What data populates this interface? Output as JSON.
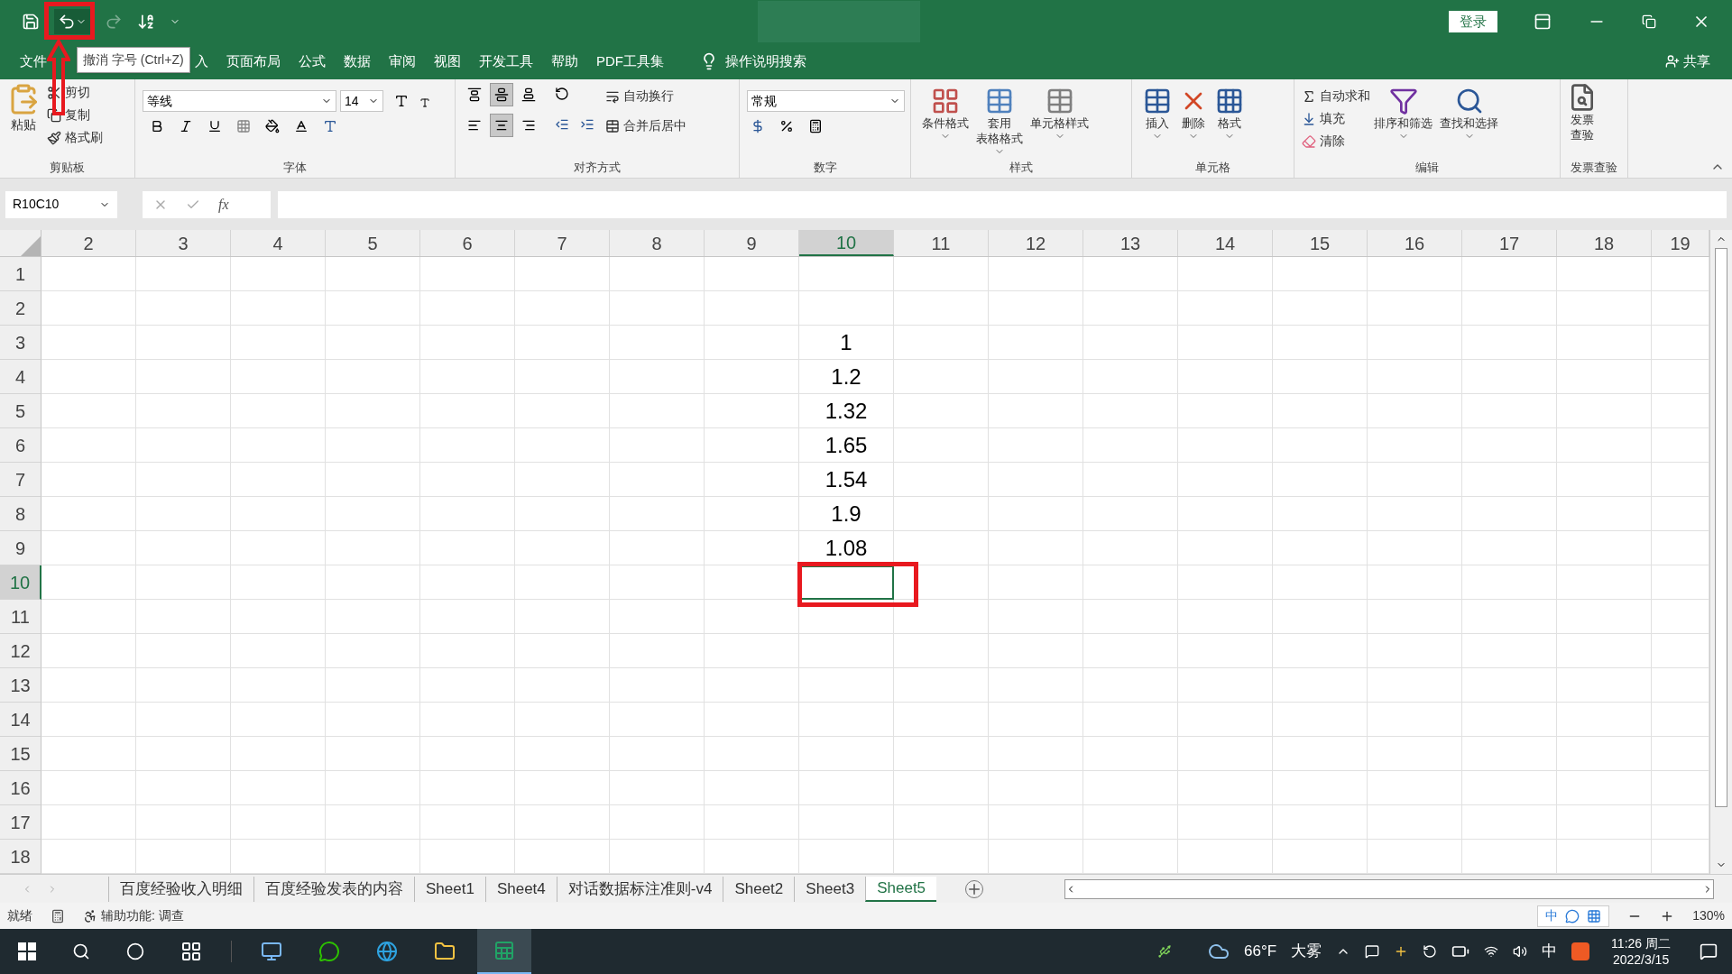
{
  "title_bar": {
    "login_button": "登录"
  },
  "menu_tabs": [
    {
      "label": "文件",
      "selected": false
    },
    {
      "label": "入",
      "selected": false
    },
    {
      "label": "页面布局",
      "selected": false
    },
    {
      "label": "公式",
      "selected": false
    },
    {
      "label": "数据",
      "selected": false
    },
    {
      "label": "审阅",
      "selected": false
    },
    {
      "label": "视图",
      "selected": false
    },
    {
      "label": "开发工具",
      "selected": false
    },
    {
      "label": "帮助",
      "selected": false
    },
    {
      "label": "PDF工具集",
      "selected": false
    }
  ],
  "tell_me": "操作说明搜索",
  "share": "共享",
  "tooltip": "撤消 字号 (Ctrl+Z)",
  "ribbon": {
    "clipboard": {
      "label": "剪贴板",
      "paste": "粘贴",
      "cut": "剪切",
      "copy": "复制",
      "format_painter": "格式刷"
    },
    "font": {
      "label": "字体",
      "name": "等线",
      "size": "14"
    },
    "alignment": {
      "label": "对齐方式",
      "vertical": [
        {
          "selected": false
        },
        {
          "selected": true
        },
        {
          "selected": false
        }
      ],
      "horizontal": [
        {
          "selected": false
        },
        {
          "selected": true
        },
        {
          "selected": false
        }
      ],
      "wrap": "自动换行",
      "merge": "合并后居中"
    },
    "number": {
      "label": "数字",
      "format": "常规"
    },
    "styles": {
      "label": "样式",
      "conditional": "条件格式",
      "table_line1": "套用",
      "table_line2": "表格格式",
      "cell_styles": "单元格样式"
    },
    "cells": {
      "label": "单元格",
      "insert": "插入",
      "delete": "删除",
      "format": "格式"
    },
    "editing": {
      "label": "编辑",
      "autosum": "自动求和",
      "fill": "填充",
      "clear": "清除",
      "sort": "排序和筛选",
      "find": "查找和选择"
    },
    "invoice": {
      "label": "发票查验",
      "line1": "发票",
      "line2": "查验"
    }
  },
  "formula_bar": {
    "name_box": "R10C10",
    "function_label": "fx"
  },
  "sheet": {
    "columns": [
      {
        "label": "2",
        "selected": false
      },
      {
        "label": "3",
        "selected": false
      },
      {
        "label": "4",
        "selected": false
      },
      {
        "label": "5",
        "selected": false
      },
      {
        "label": "6",
        "selected": false
      },
      {
        "label": "7",
        "selected": false
      },
      {
        "label": "8",
        "selected": false
      },
      {
        "label": "9",
        "selected": false
      },
      {
        "label": "10",
        "selected": true
      },
      {
        "label": "11",
        "selected": false
      },
      {
        "label": "12",
        "selected": false
      },
      {
        "label": "13",
        "selected": false
      },
      {
        "label": "14",
        "selected": false
      },
      {
        "label": "15",
        "selected": false
      },
      {
        "label": "16",
        "selected": false
      },
      {
        "label": "17",
        "selected": false
      },
      {
        "label": "18",
        "selected": false
      },
      {
        "label": "19",
        "selected": false
      }
    ],
    "rows": [
      {
        "label": "1",
        "selected": false
      },
      {
        "label": "2",
        "selected": false
      },
      {
        "label": "3",
        "selected": false,
        "cells": [
          null,
          null,
          null,
          null,
          null,
          null,
          null,
          null,
          "1",
          null,
          null,
          null,
          null,
          null,
          null,
          null,
          null,
          null
        ]
      },
      {
        "label": "4",
        "selected": false,
        "cells": [
          null,
          null,
          null,
          null,
          null,
          null,
          null,
          null,
          "1.2",
          null,
          null,
          null,
          null,
          null,
          null,
          null,
          null,
          null
        ]
      },
      {
        "label": "5",
        "selected": false,
        "cells": [
          null,
          null,
          null,
          null,
          null,
          null,
          null,
          null,
          "1.32",
          null,
          null,
          null,
          null,
          null,
          null,
          null,
          null,
          null
        ]
      },
      {
        "label": "6",
        "selected": false,
        "cells": [
          null,
          null,
          null,
          null,
          null,
          null,
          null,
          null,
          "1.65",
          null,
          null,
          null,
          null,
          null,
          null,
          null,
          null,
          null
        ]
      },
      {
        "label": "7",
        "selected": false,
        "cells": [
          null,
          null,
          null,
          null,
          null,
          null,
          null,
          null,
          "1.54",
          null,
          null,
          null,
          null,
          null,
          null,
          null,
          null,
          null
        ]
      },
      {
        "label": "8",
        "selected": false,
        "cells": [
          null,
          null,
          null,
          null,
          null,
          null,
          null,
          null,
          "1.9",
          null,
          null,
          null,
          null,
          null,
          null,
          null,
          null,
          null
        ]
      },
      {
        "label": "9",
        "selected": false,
        "cells": [
          null,
          null,
          null,
          null,
          null,
          null,
          null,
          null,
          "1.08",
          null,
          null,
          null,
          null,
          null,
          null,
          null,
          null,
          null
        ]
      },
      {
        "label": "10",
        "selected": true
      },
      {
        "label": "11",
        "selected": false
      },
      {
        "label": "12",
        "selected": false
      },
      {
        "label": "13",
        "selected": false
      },
      {
        "label": "14",
        "selected": false
      },
      {
        "label": "15",
        "selected": false
      },
      {
        "label": "16",
        "selected": false
      },
      {
        "label": "17",
        "selected": false
      },
      {
        "label": "18",
        "selected": false
      }
    ]
  },
  "sheet_tabs": [
    {
      "label": "百度经验收入明细",
      "selected": false
    },
    {
      "label": "百度经验发表的内容",
      "selected": false
    },
    {
      "label": "Sheet1",
      "selected": false
    },
    {
      "label": "Sheet4",
      "selected": false
    },
    {
      "label": "对话数据标注准则-v4",
      "selected": false
    },
    {
      "label": "Sheet2",
      "selected": false
    },
    {
      "label": "Sheet3",
      "selected": false
    },
    {
      "label": "Sheet5",
      "selected": true
    }
  ],
  "status_bar": {
    "mode": "就绪",
    "accessibility": "辅助功能: 调查",
    "ime": "中",
    "zoom": "130%"
  },
  "taskbar": {
    "temperature": "66°F",
    "weather": "大雾",
    "input_language": "中",
    "time": "11:26 周二",
    "date": "2022/3/15"
  }
}
